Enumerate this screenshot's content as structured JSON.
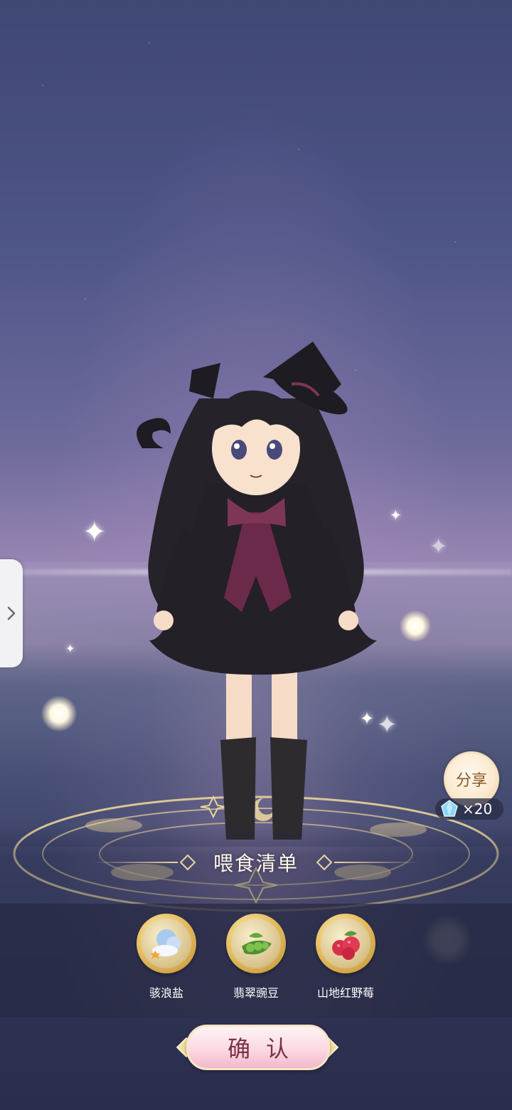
{
  "feeding_list": {
    "title": "喂食清单",
    "items": [
      {
        "name": "骇浪盐",
        "icon": "salt-icon"
      },
      {
        "name": "翡翠豌豆",
        "icon": "peas-icon"
      },
      {
        "name": "山地红野莓",
        "icon": "raspberry-icon"
      }
    ]
  },
  "share": {
    "label": "分享",
    "reward_count": "×20",
    "reward_icon": "diamond-gem-icon"
  },
  "confirm": {
    "label": "确认"
  },
  "side_panel": {
    "icon": "chevron-right-icon"
  },
  "colors": {
    "panel": "#262842",
    "confirm_text": "#7b3245",
    "accent_gold": "#e9d6a0"
  }
}
